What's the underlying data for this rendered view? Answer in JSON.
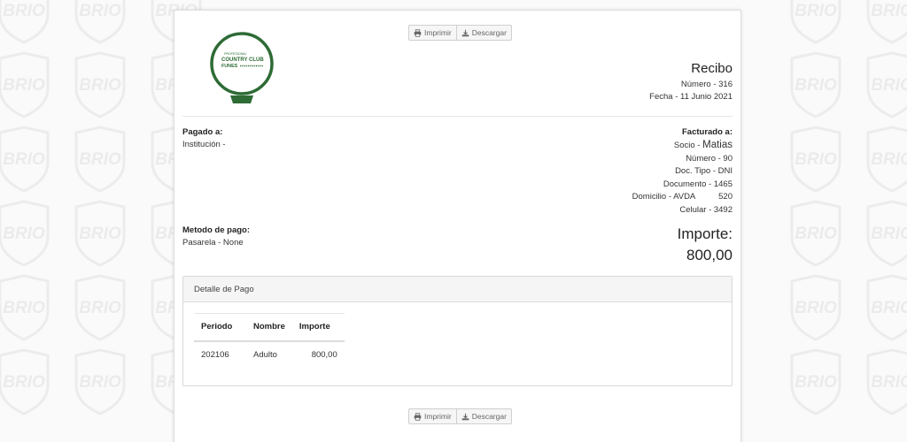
{
  "watermark": {
    "brand": "BRIO"
  },
  "toolbar": {
    "print_label": "Imprimir",
    "download_label": "Descargar"
  },
  "logo": {
    "line1": "PROFESIONAL",
    "line2": "COUNTRY CLUB",
    "line3": "FUNES",
    "color": "#2e6b35"
  },
  "receipt": {
    "title": "Recibo",
    "number": "Número - 316",
    "date": "Fecha - 11 Junio 2021"
  },
  "paid_to": {
    "label": "Pagado a:",
    "institution": "Institución -"
  },
  "billed_to": {
    "label": "Facturado a:",
    "socio_prefix": "Socio - ",
    "socio_name": "Matias",
    "number": "Número - 90",
    "doc_type": "Doc. Tipo - DNI",
    "document": "Documento - 1465",
    "domicilio": "Domicilio - AVDA          520",
    "celular": "Celular - 3492"
  },
  "payment_method": {
    "label": "Metodo de pago:",
    "value": "Pasarela - None"
  },
  "amount": {
    "label": "Importe:",
    "value": "800,00"
  },
  "detail": {
    "title": "Detalle de Pago",
    "columns": {
      "periodo": "Periodo",
      "nombre": "Nombre",
      "importe": "Importe"
    },
    "rows": [
      {
        "periodo": "202106",
        "nombre": "Adulto",
        "importe": "800,00"
      }
    ]
  }
}
